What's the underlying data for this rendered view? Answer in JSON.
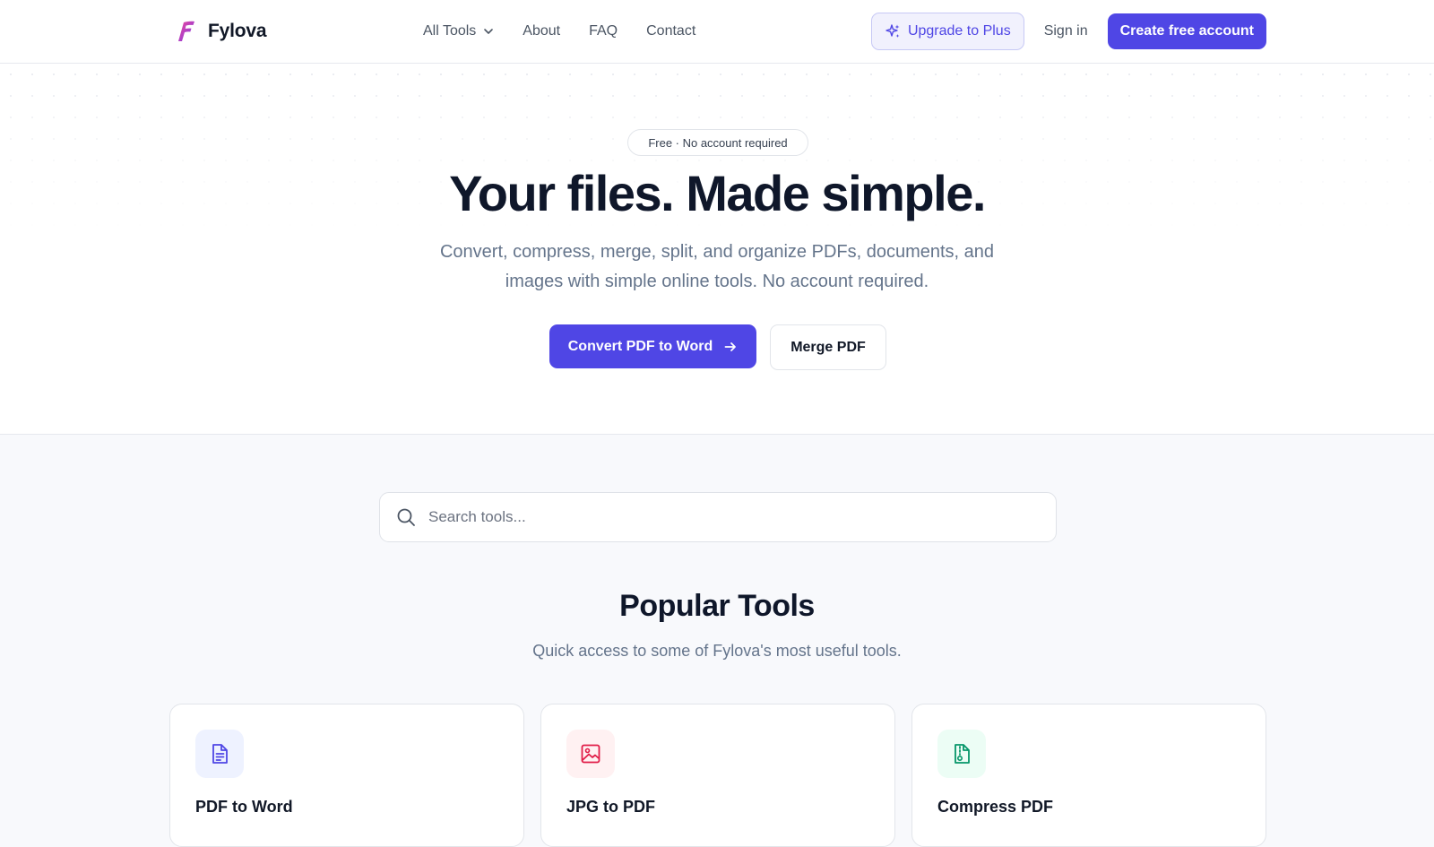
{
  "brand": {
    "name": "Fylova",
    "logo_colors": [
      "#ec4899",
      "#7c3aed"
    ]
  },
  "nav": {
    "links": [
      {
        "label": "All Tools",
        "has_dropdown": true
      },
      {
        "label": "About"
      },
      {
        "label": "FAQ"
      },
      {
        "label": "Contact"
      }
    ],
    "upgrade_label": "Upgrade to Plus",
    "signin_label": "Sign in",
    "create_label": "Create free account"
  },
  "hero": {
    "badge": "Free · No account required",
    "title": "Your files. Made simple.",
    "subtitle": "Convert, compress, merge, split, and organize PDFs, documents, and images with simple online tools. No account required.",
    "primary_cta": "Convert PDF to Word",
    "secondary_cta": "Merge PDF"
  },
  "search": {
    "placeholder": "Search tools...",
    "value": ""
  },
  "popular": {
    "title": "Popular Tools",
    "subtitle": "Quick access to some of Fylova's most useful tools.",
    "cards": [
      {
        "title": "PDF to Word",
        "icon": "document-icon",
        "accent": "#4f46e5",
        "bg": "#eef2ff"
      },
      {
        "title": "JPG to PDF",
        "icon": "image-icon",
        "accent": "#e11d48",
        "bg": "#fff1f2"
      },
      {
        "title": "Compress PDF",
        "icon": "file-archive-icon",
        "accent": "#059669",
        "bg": "#ecfdf5"
      }
    ]
  },
  "colors": {
    "primary": "#4f46e5",
    "text": "#0f172a",
    "muted": "#64748b",
    "border": "#e2e5ea"
  }
}
